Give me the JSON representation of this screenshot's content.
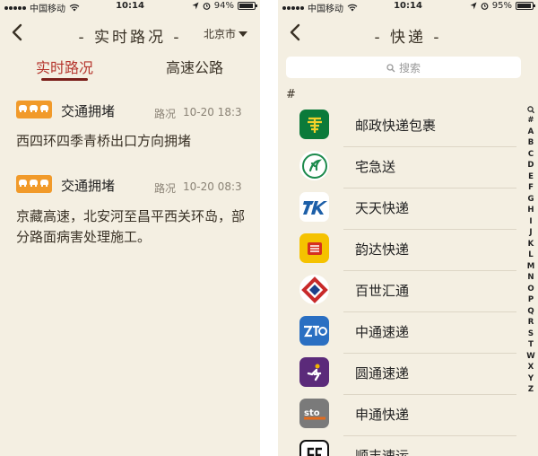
{
  "left": {
    "status": {
      "carrier": "中国移动",
      "time": "10:14",
      "battery": "94%",
      "battery_level": 0.94
    },
    "nav": {
      "title": "- 实时路况 -",
      "city": "北京市"
    },
    "tabs": [
      {
        "label": "实时路况",
        "active": true
      },
      {
        "label": "高速公路",
        "active": false
      }
    ],
    "items": [
      {
        "type": "交通拥堵",
        "category": "路况",
        "time": "10-20 18:3",
        "description": "西四环四季青桥出口方向拥堵"
      },
      {
        "type": "交通拥堵",
        "category": "路况",
        "time": "10-20 08:3",
        "description": "京藏高速，北安河至昌平西关环岛，部分路面病害处理施工。"
      }
    ]
  },
  "right": {
    "status": {
      "carrier": "中国移动",
      "time": "10:14",
      "battery": "95%",
      "battery_level": 0.95
    },
    "nav": {
      "title": "- 快递 -"
    },
    "search": {
      "placeholder": "搜索"
    },
    "section": "#",
    "couriers": [
      {
        "name": "邮政快递包裹",
        "icon": "china-post-logo",
        "color": "#0b7a3a"
      },
      {
        "name": "宅急送",
        "icon": "zjs-logo",
        "color": "#1c8a4c"
      },
      {
        "name": "天天快递",
        "icon": "ttk-logo",
        "color": "#1d5fa8"
      },
      {
        "name": "韵达快递",
        "icon": "yunda-logo",
        "color": "#f5c200"
      },
      {
        "name": "百世汇通",
        "icon": "best-logo",
        "color": "#c82a2a"
      },
      {
        "name": "中通速递",
        "icon": "zto-logo",
        "color": "#2a6fc2"
      },
      {
        "name": "圆通速递",
        "icon": "yto-logo",
        "color": "#5b2a7a"
      },
      {
        "name": "申通快递",
        "icon": "sto-logo",
        "color": "#e26b1d"
      },
      {
        "name": "顺丰速运",
        "icon": "sf-logo",
        "color": "#111111"
      }
    ],
    "index_letters": [
      "#",
      "A",
      "B",
      "C",
      "D",
      "E",
      "F",
      "G",
      "H",
      "I",
      "J",
      "K",
      "L",
      "M",
      "N",
      "O",
      "P",
      "Q",
      "R",
      "S",
      "T",
      "W",
      "X",
      "Y",
      "Z"
    ]
  }
}
